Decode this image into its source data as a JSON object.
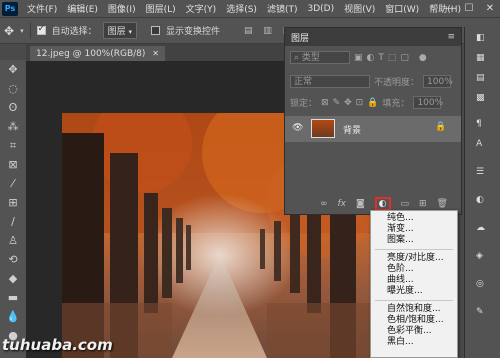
{
  "menubar": {
    "logo": "Ps",
    "items": [
      "文件(F)",
      "编辑(E)",
      "图像(I)",
      "图层(L)",
      "文字(Y)",
      "选择(S)",
      "滤镜(T)",
      "3D(D)",
      "视图(V)",
      "窗口(W)",
      "帮助(H)"
    ],
    "minimize": "—",
    "restore": "☐",
    "close": "✕"
  },
  "options": {
    "auto_select_label": "自动选择：",
    "auto_select_value": "图层",
    "show_transform_label": "显示变换控件"
  },
  "document": {
    "tab_title": "12.jpeg @ 100%(RGB/8)",
    "close": "✕"
  },
  "watermark": "tuhuaba.com",
  "layers_panel": {
    "title": "图层",
    "filter_kind": "类型",
    "blend_mode": "正常",
    "opacity_label": "不透明度：",
    "opacity_value": "100%",
    "lock_label": "锁定：",
    "fill_label": "填充：",
    "fill_value": "100%",
    "layer_name": "背景",
    "fx_label": "fx"
  },
  "adjustment_menu": {
    "groups": [
      [
        "纯色...",
        "渐变...",
        "图案..."
      ],
      [
        "亮度/对比度...",
        "色阶...",
        "曲线...",
        "曝光度..."
      ],
      [
        "自然饱和度...",
        "色相/饱和度...",
        "色彩平衡...",
        "黑白..."
      ]
    ]
  },
  "colors": {
    "accent_red": "#e0302a",
    "panel_bg": "#535353",
    "header_bg": "#3c3c3c"
  }
}
